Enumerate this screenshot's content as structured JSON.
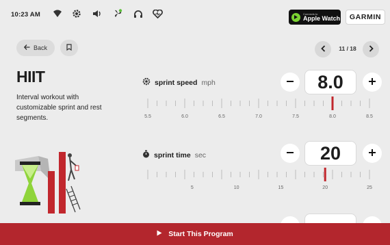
{
  "status": {
    "time": "10:23 AM",
    "icons": [
      "wifi-icon",
      "settings-icon",
      "volume-icon",
      "fan-icon",
      "headphones-icon",
      "heart-rate-icon"
    ]
  },
  "badges": {
    "watch_small": "Connects to",
    "watch_label": "Apple Watch",
    "garmin_label": "GARMIN"
  },
  "nav": {
    "back_label": "Back",
    "pager": "11 / 18"
  },
  "workout": {
    "title": "HIIT",
    "description": "Interval workout with customizable sprint and rest segments."
  },
  "params": [
    {
      "name": "sprint speed",
      "unit": "mph",
      "value": "8.0",
      "ticks": [
        "5.5",
        "6.0",
        "6.5",
        "7.0",
        "7.5",
        "8.0",
        "8.5"
      ],
      "selected": 8.0,
      "min": 5.5,
      "max": 8.5
    },
    {
      "name": "sprint time",
      "unit": "sec",
      "value": "20",
      "ticks": [
        "5",
        "10",
        "15",
        "20",
        "25"
      ],
      "selected": 20,
      "min": 0,
      "max": 25
    }
  ],
  "cta": {
    "label": "Start This Program"
  },
  "colors": {
    "accent": "#b3262d",
    "background": "#ececec",
    "marker": "#c1272d"
  }
}
